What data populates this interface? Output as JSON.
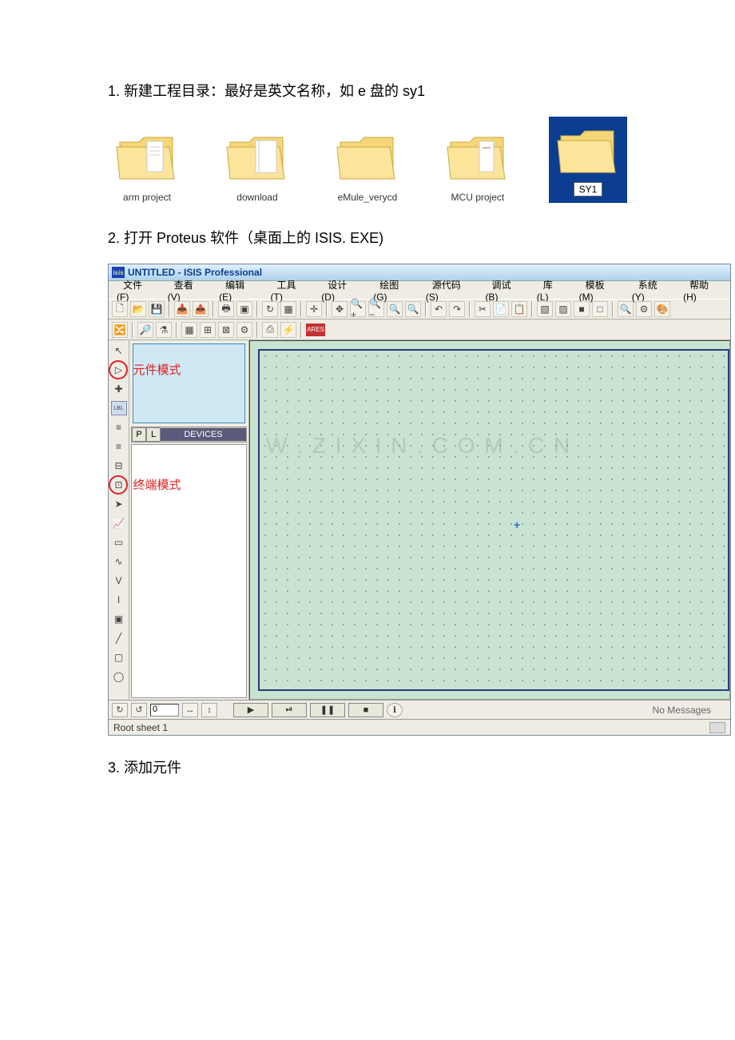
{
  "step1": {
    "text": "1. 新建工程目录：最好是英文名称，如 e 盘的 sy1"
  },
  "folders": {
    "items": [
      {
        "label": "arm project"
      },
      {
        "label": "download"
      },
      {
        "label": "eMule_verycd"
      },
      {
        "label": "MCU project"
      },
      {
        "label": "SY1"
      }
    ]
  },
  "step2": {
    "text": "2. 打开 Proteus 软件（桌面上的 ISIS. EXE)"
  },
  "proteus": {
    "titlebar_icon": "isis",
    "title": "UNTITLED - ISIS Professional",
    "menu": {
      "file": "文件(F)",
      "view": "查看(V)",
      "edit": "编辑(E)",
      "tools": "工具(T)",
      "design": "设计(D)",
      "graph": "绘图(G)",
      "source": "源代码(S)",
      "debug": "调试(B)",
      "library": "库(L)",
      "template": "模板(M)",
      "system": "系统(Y)",
      "help": "帮助(H)"
    },
    "toolbar": {
      "new": "🗋",
      "open": "📂",
      "save": "💾",
      "grid": "▦",
      "pan": "✥",
      "zin": "🔍+",
      "zout": "🔍−",
      "undo": "↶",
      "redo": "↷",
      "cut": "✂",
      "copy": "📄",
      "paste": "📋",
      "t1": "▧",
      "t2": "▨",
      "t3": "■",
      "t4": "□",
      "m1": "🔍",
      "m2": "⚙"
    },
    "toolbar2": {
      "g1": "🔀",
      "g2": "🔎",
      "g3": "⚗",
      "g4": "▦",
      "g5": "⊞",
      "g6": "⊠",
      "g7": "⚙",
      "g8": "⎙",
      "g9": "⚡",
      "ares": "ARES"
    },
    "annotations": {
      "component_mode": "元件模式",
      "terminal_mode": "终端模式"
    },
    "left_icons": {
      "pointer": "↖",
      "component": "▷",
      "junction": "✚",
      "label": "LBL",
      "script": "≡",
      "bus": "≡",
      "subcircuit": "⊟",
      "terminal": "⊡",
      "pin": "➤",
      "graph": "📈",
      "tape": "▭",
      "gen": "∿",
      "vprobe": "V",
      "iprobe": "I",
      "inst": "▣",
      "line": "╱",
      "box": "▢",
      "circle": "◯"
    },
    "side": {
      "p": "P",
      "l": "L",
      "devices": "DEVICES"
    },
    "watermark": "W  .  Z I X I N . C O M . C N",
    "plus": "+",
    "bottom": {
      "rotcw": "↻",
      "rotccw": "↺",
      "value": "0",
      "fliph": "↔",
      "flipv": "↕",
      "play": "▶",
      "step": "⏯",
      "pause": "❚❚",
      "stop": "■",
      "info": "ℹ",
      "msg": "No Messages"
    },
    "status": {
      "sheet": "Root sheet 1"
    }
  },
  "step3": {
    "text": "3. 添加元件"
  }
}
